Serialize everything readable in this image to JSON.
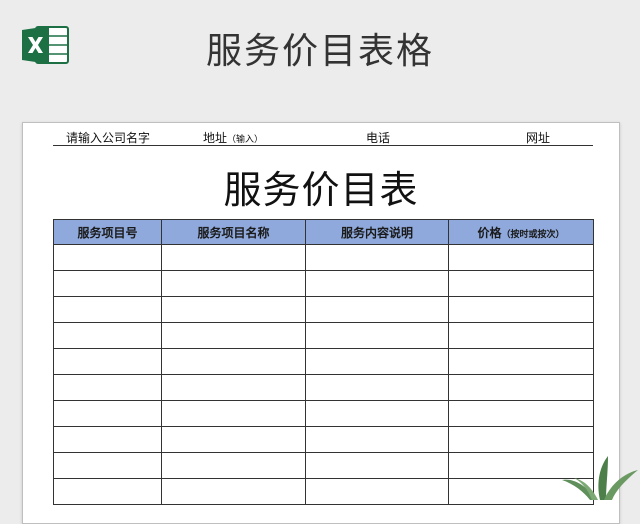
{
  "banner": {
    "title": "服务价目表格",
    "logo_icon": "excel-logo-icon"
  },
  "header_info": {
    "company": "请输入公司名字",
    "address_label": "地址",
    "address_hint": "（输入）",
    "phone": "电话",
    "website": "网址"
  },
  "document": {
    "title": "服务价目表"
  },
  "table": {
    "columns": [
      {
        "label": "服务项目号",
        "note": ""
      },
      {
        "label": "服务项目名称",
        "note": ""
      },
      {
        "label": "服务内容说明",
        "note": ""
      },
      {
        "label": "价格",
        "note": "（按时或按次）"
      }
    ],
    "row_count": 10
  },
  "colors": {
    "header_fill": "#8fa9dc",
    "excel_green": "#1d7044",
    "background": "#ececec"
  }
}
